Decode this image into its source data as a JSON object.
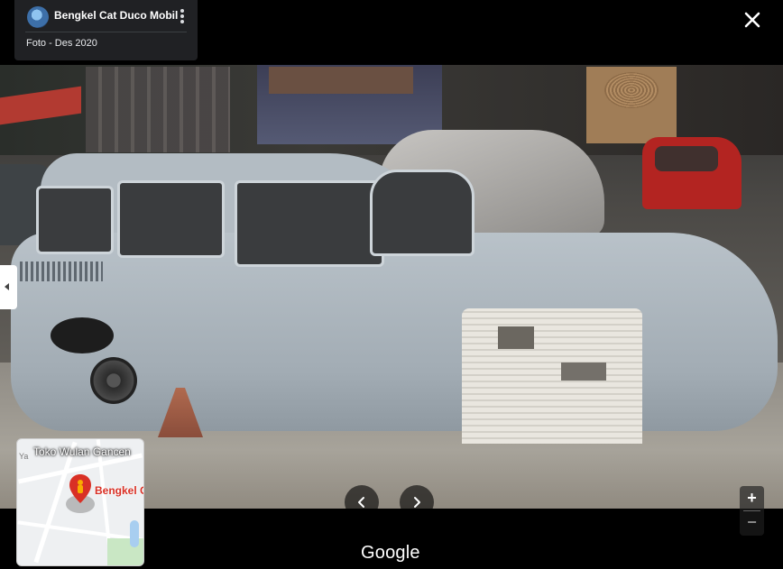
{
  "header": {
    "place_title": "Bengkel Cat Duco Mobil",
    "photo_date": "Foto - Des 2020"
  },
  "icons": {
    "avatar": "place-avatar-icon",
    "more": "more-vert-icon",
    "close": "close-icon",
    "collapse": "chevron-left-icon",
    "prev": "chevron-left-icon",
    "next": "chevron-right-icon",
    "pin": "map-pin-icon"
  },
  "minimap": {
    "title": "Toko Wulan Gancen",
    "place_label": "Bengkel C",
    "street": "Ya"
  },
  "zoom": {
    "in_label": "+",
    "out_label": "−"
  },
  "footer": {
    "brand": "Google"
  },
  "colors": {
    "card_bg": "#202124",
    "pin_red": "#d93025",
    "pin_person": "#f9ab00"
  }
}
